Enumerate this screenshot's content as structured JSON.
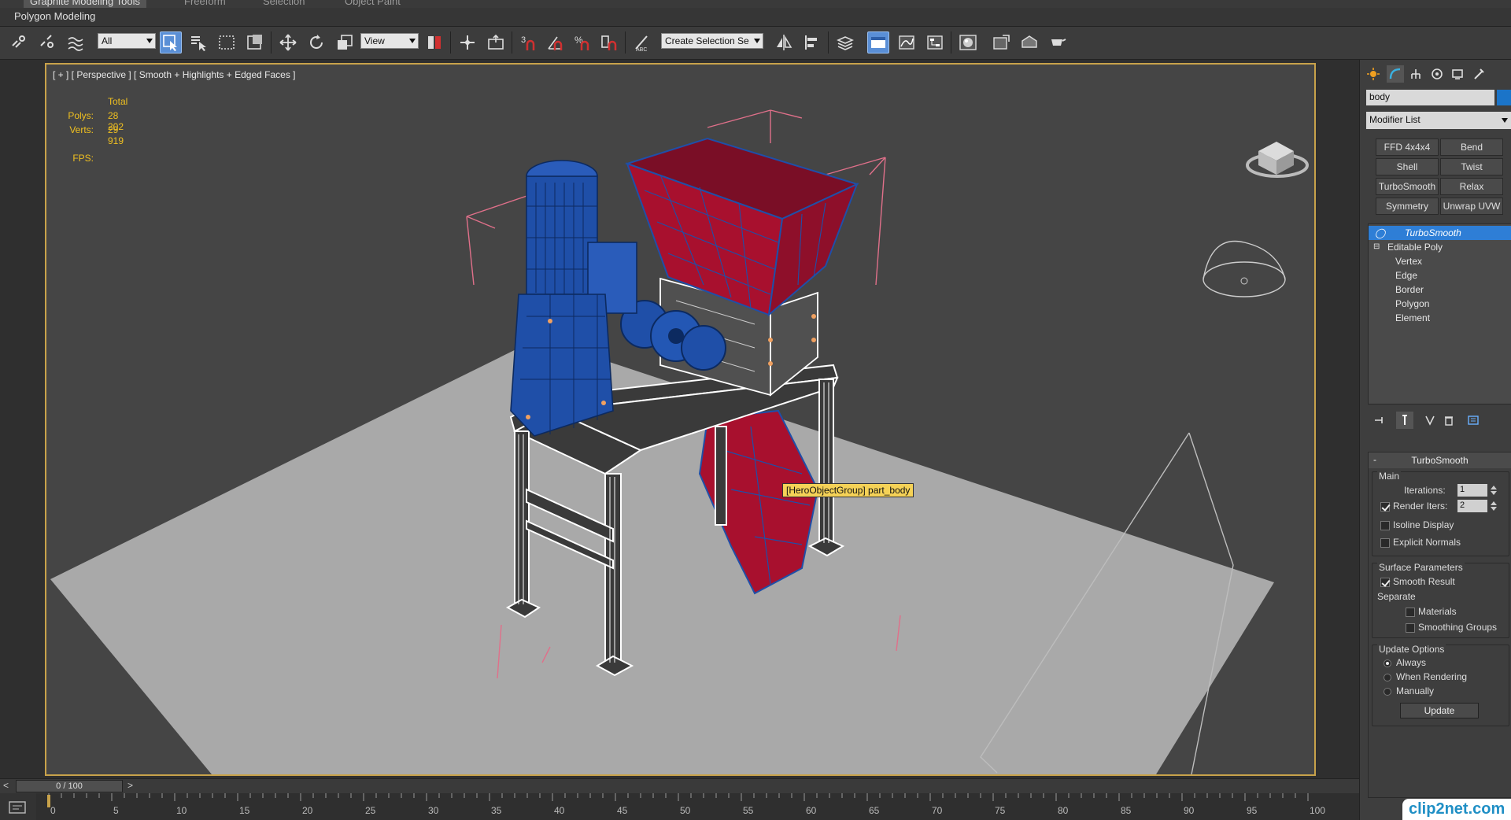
{
  "ribbon": {
    "tabs": [
      "Graphite Modeling Tools",
      "Freeform",
      "Selection",
      "Object Paint"
    ],
    "active_tab": 0,
    "sub_label": "Polygon Modeling"
  },
  "toolbar": {
    "selection_filter": "All",
    "ref_coord": "View",
    "named_selection_placeholder": "Create Selection Se",
    "snap_label": "3",
    "icons": [
      "link-icon",
      "unlink-icon",
      "bind-spacewarp-icon",
      "select-object-icon",
      "select-by-name-icon",
      "rect-region-icon",
      "window-crossing-icon",
      "move-icon",
      "rotate-icon",
      "scale-icon",
      "pivot-icon",
      "manipulate-icon",
      "keyboard-shortcut-icon",
      "snap-icon",
      "angle-snap-icon",
      "percent-snap-icon",
      "spinner-snap-icon",
      "edit-named-sel-icon",
      "mirror-icon",
      "align-icon",
      "layer-manager-icon",
      "ribbon-toggle-icon",
      "curve-editor-icon",
      "schematic-view-icon",
      "material-editor-icon",
      "render-setup-icon",
      "rendered-frame-icon",
      "render-icon"
    ]
  },
  "viewport": {
    "label": "[ + ] [ Perspective ] [ Smooth + Highlights + Edged Faces ]",
    "stats": {
      "header": "Total",
      "polys_label": "Polys:",
      "polys": "28 202",
      "verts_label": "Verts:",
      "verts": "29 919",
      "fps_label": "FPS:"
    },
    "tooltip": "[HeroObjectGroup] part_body",
    "colors": {
      "motor": "#1f4fa8",
      "hopper": "#a8102e",
      "frame": "#ffffff",
      "ground": "#a9a9a9",
      "background": "#454545"
    }
  },
  "command_panel": {
    "object_name": "body",
    "object_color": "#1b74c8",
    "modifier_list": "Modifier List",
    "modifier_buttons": [
      "FFD 4x4x4",
      "Bend",
      "Shell",
      "Twist",
      "TurboSmooth",
      "Relax",
      "Symmetry",
      "Unwrap UVW"
    ],
    "stack": [
      {
        "label": "TurboSmooth",
        "selected": true,
        "indent": 0
      },
      {
        "label": "Editable Poly",
        "selected": false,
        "indent": 0
      },
      {
        "label": "Vertex",
        "selected": false,
        "indent": 1
      },
      {
        "label": "Edge",
        "selected": false,
        "indent": 1
      },
      {
        "label": "Border",
        "selected": false,
        "indent": 1
      },
      {
        "label": "Polygon",
        "selected": false,
        "indent": 1
      },
      {
        "label": "Element",
        "selected": false,
        "indent": 1
      }
    ],
    "rollout": {
      "title": "TurboSmooth",
      "collapse": "-",
      "main_label": "Main",
      "iterations_label": "Iterations:",
      "iterations": "1",
      "render_iters_label": "Render Iters:",
      "render_iters": "2",
      "render_iters_checked": true,
      "isoline_label": "Isoline Display",
      "isoline_checked": false,
      "explicit_normals_label": "Explicit Normals",
      "explicit_normals_checked": false,
      "surface_label": "Surface Parameters",
      "smooth_result_label": "Smooth Result",
      "smooth_result_checked": true,
      "separate_label": "Separate",
      "materials_label": "Materials",
      "smoothing_groups_label": "Smoothing Groups",
      "update_options_label": "Update Options",
      "always_label": "Always",
      "when_rendering_label": "When Rendering",
      "manually_label": "Manually",
      "selected_update": "Always",
      "update_button": "Update"
    }
  },
  "timeline": {
    "current": "0 / 100",
    "prev": "<",
    "next": ">",
    "ticks": [
      "0",
      "5",
      "10",
      "15",
      "20",
      "25",
      "30",
      "35",
      "40",
      "45",
      "50",
      "55",
      "60",
      "65",
      "70",
      "75",
      "80",
      "85",
      "90",
      "95",
      "100"
    ]
  },
  "watermark": "clip2net.com"
}
